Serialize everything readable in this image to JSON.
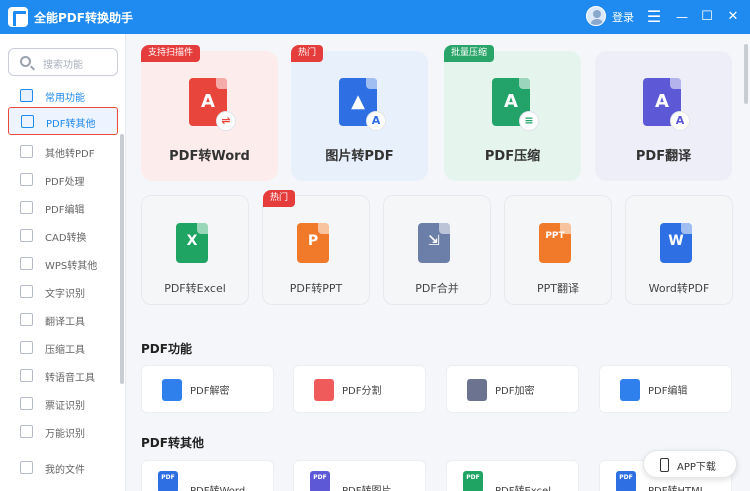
{
  "titlebar": {
    "app_title": "全能PDF转换助手",
    "login": "登录",
    "controls": {
      "menu": "☰",
      "min": "—",
      "max": "☐",
      "close": "✕"
    }
  },
  "sidebar": {
    "search_placeholder": "搜索功能",
    "items": [
      {
        "label": "常用功能",
        "icon": "star-icon"
      },
      {
        "label": "PDF转其他",
        "icon": "pdf-icon"
      },
      {
        "label": "其他转PDF",
        "icon": "convert-icon"
      },
      {
        "label": "PDF处理",
        "icon": "tool-icon"
      },
      {
        "label": "PDF编辑",
        "icon": "edit-icon"
      },
      {
        "label": "CAD转换",
        "icon": "cad-icon"
      },
      {
        "label": "WPS转其他",
        "icon": "wps-icon"
      },
      {
        "label": "文字识别",
        "icon": "ocr-icon"
      },
      {
        "label": "翻译工具",
        "icon": "translate-icon"
      },
      {
        "label": "压缩工具",
        "icon": "compress-icon"
      },
      {
        "label": "转语音工具",
        "icon": "voice-icon"
      },
      {
        "label": "票证识别",
        "icon": "ticket-icon"
      },
      {
        "label": "万能识别",
        "icon": "scan-icon"
      },
      {
        "label": "我的文件",
        "icon": "folder-icon"
      }
    ]
  },
  "big_cards": [
    {
      "label": "PDF转Word",
      "badge": "支持扫描件",
      "bg": "#fdecec",
      "icon_color": "#e8453c",
      "sym": "A",
      "sub": "⇌"
    },
    {
      "label": "图片转PDF",
      "badge": "热门",
      "bg": "#e8f0fc",
      "icon_color": "#2f6fe4",
      "sym": "▲",
      "sub": "A"
    },
    {
      "label": "PDF压缩",
      "badge": "批量压缩",
      "bg": "#e5f5ee",
      "icon_color": "#23a36a",
      "sym": "A",
      "sub": "≡"
    },
    {
      "label": "PDF翻译",
      "badge": "",
      "bg": "#eeeef8",
      "icon_color": "#5c58d6",
      "sym": "A",
      "sub": "A"
    }
  ],
  "small_cards": [
    {
      "label": "PDF转Excel",
      "badge": "",
      "icon_color": "#1fa463",
      "sym": "X"
    },
    {
      "label": "PDF转PPT",
      "badge": "热门",
      "icon_color": "#f07a2a",
      "sym": "P"
    },
    {
      "label": "PDF合并",
      "badge": "",
      "icon_color": "#6b7fa8",
      "sym": "⇲"
    },
    {
      "label": "PPT翻译",
      "badge": "",
      "icon_color": "#f07a2a",
      "sym": "PPT"
    },
    {
      "label": "Word转PDF",
      "badge": "",
      "icon_color": "#2f6fe4",
      "sym": "W"
    }
  ],
  "sections": {
    "pdf_functions": {
      "title": "PDF功能",
      "items": [
        {
          "label": "PDF解密",
          "color": "#2f80ed"
        },
        {
          "label": "PDF分割",
          "color": "#ef5b5b"
        },
        {
          "label": "PDF加密",
          "color": "#6b7391"
        },
        {
          "label": "PDF编辑",
          "color": "#2f80ed"
        }
      ]
    },
    "pdf_to_other": {
      "title": "PDF转其他",
      "items": [
        {
          "label": "PDF转Word",
          "color": "#2f6fe4"
        },
        {
          "label": "PDF转图片",
          "color": "#5c58d6"
        },
        {
          "label": "PDF转Excel",
          "color": "#1fa463"
        },
        {
          "label": "PDF转HTML",
          "color": "#2f6fe4"
        }
      ]
    }
  },
  "app_download": "APP下载"
}
